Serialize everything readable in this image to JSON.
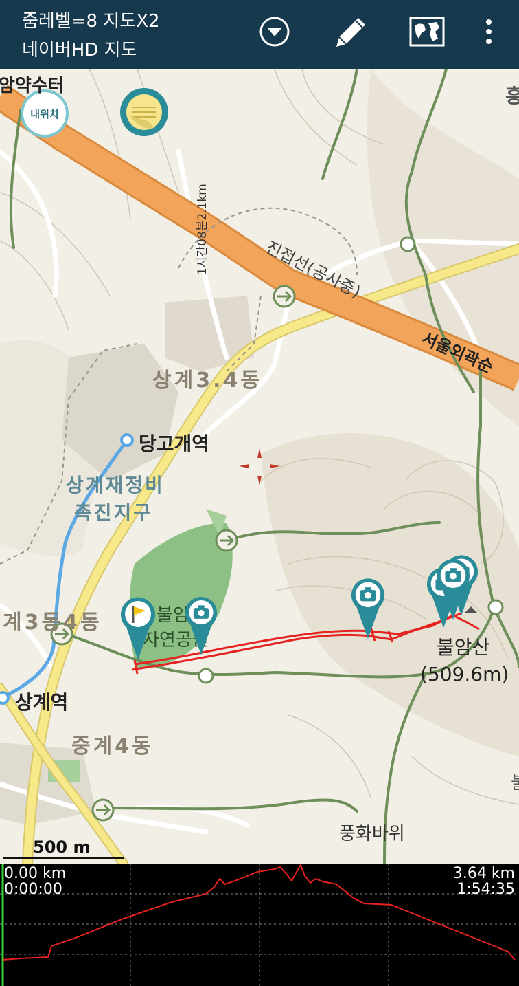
{
  "header": {
    "zoom_level_text": "줌레벨=8 지도X2",
    "map_source_text": "네이버HD 지도",
    "icons": [
      "dropdown-icon",
      "pencil-icon",
      "world-map-icon",
      "overflow-menu-icon"
    ]
  },
  "map": {
    "buttons": {
      "my_location_label": "내위치"
    },
    "labels": {
      "top_left_partial": "암약수터",
      "top_right_partial": "흥",
      "jinjeopseon": "진접선(공사중)",
      "seoul_ring": "서울외곽순",
      "area_sanggye34": "상계3.4동",
      "station_danggogae": "당고개역",
      "area_jaejeongbi_line1": "상계재정비",
      "area_jaejeongbi_line2": "촉진지구",
      "area_gye34": "계3동4동",
      "park_line1": "불암",
      "park_line2": "자연공원",
      "station_sanggye": "상계역",
      "area_junggye4": "중계4동",
      "mountain_name": "불암산",
      "mountain_height": "(509.6m)",
      "pungwha": "풍화바위",
      "right_edge_partial": "불",
      "route_vertical": "1시간08분2.1km"
    },
    "scale_bar": "500 m",
    "colors": {
      "header_bg": "#17394d",
      "highway": "#f2a45a",
      "major_road": "#f7e98a",
      "trail": "#6e8e5a",
      "track": "#e52320",
      "marker": "#2a8c99",
      "subway": "#5ba8e5",
      "park": "#8cc085"
    }
  },
  "profile": {
    "start_distance": "0.00 km",
    "start_time": "0:00:00",
    "end_distance": "3.64 km",
    "end_time": "1:54:35"
  }
}
